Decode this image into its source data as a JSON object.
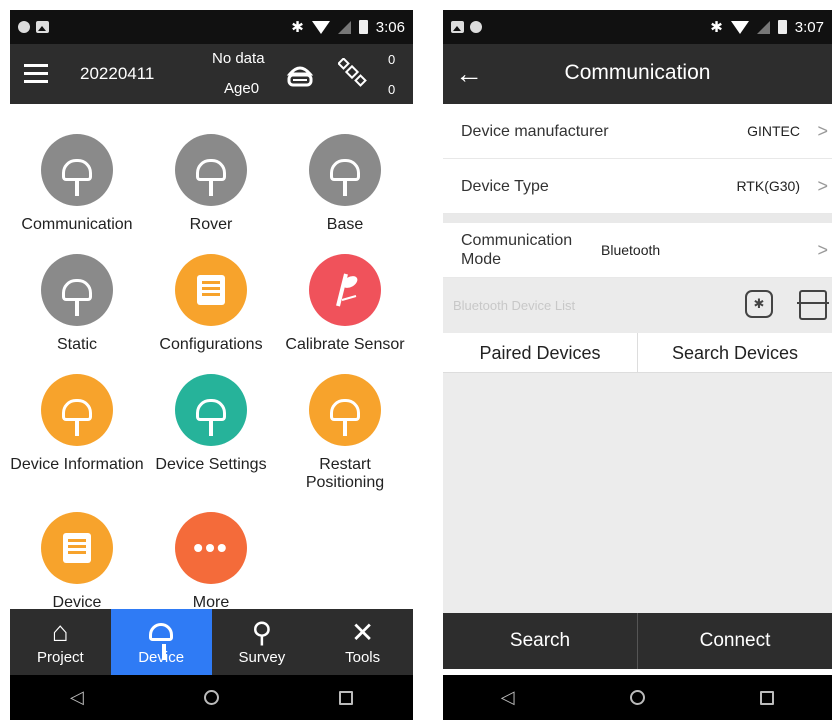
{
  "left": {
    "status": {
      "time": "3:06"
    },
    "header": {
      "title": "20220411",
      "nodata": "No data",
      "age": "Age0",
      "count1": "0",
      "count2": "0"
    },
    "tiles": [
      {
        "label": "Communication"
      },
      {
        "label": "Rover"
      },
      {
        "label": "Base"
      },
      {
        "label": "Static"
      },
      {
        "label": "Configurations"
      },
      {
        "label": "Calibrate Sensor"
      },
      {
        "label": "Device Information"
      },
      {
        "label": "Device Settings"
      },
      {
        "label": "Restart Positioning"
      },
      {
        "label": "Device"
      },
      {
        "label": "More"
      }
    ],
    "nav": [
      {
        "label": "Project",
        "icon": "home-icon"
      },
      {
        "label": "Device",
        "icon": "device-icon"
      },
      {
        "label": "Survey",
        "icon": "survey-icon"
      },
      {
        "label": "Tools",
        "icon": "tools-icon"
      }
    ]
  },
  "right": {
    "status": {
      "time": "3:07"
    },
    "header": {
      "title": "Communication"
    },
    "rows": [
      {
        "label": "Device manufacturer",
        "value": "GINTEC"
      },
      {
        "label": "Device Type",
        "value": "RTK(G30)"
      },
      {
        "label": "Communication Mode",
        "value": "Bluetooth"
      }
    ],
    "bt_list_label": "Bluetooth Device List",
    "tabs": [
      "Paired Devices",
      "Search Devices"
    ],
    "actions": [
      "Search",
      "Connect"
    ]
  },
  "colors": {
    "accent": "#2f7bf5",
    "dark": "#2d2d2d",
    "orange": "#f7a32c",
    "teal": "#26b39a",
    "red": "#f0525b"
  }
}
